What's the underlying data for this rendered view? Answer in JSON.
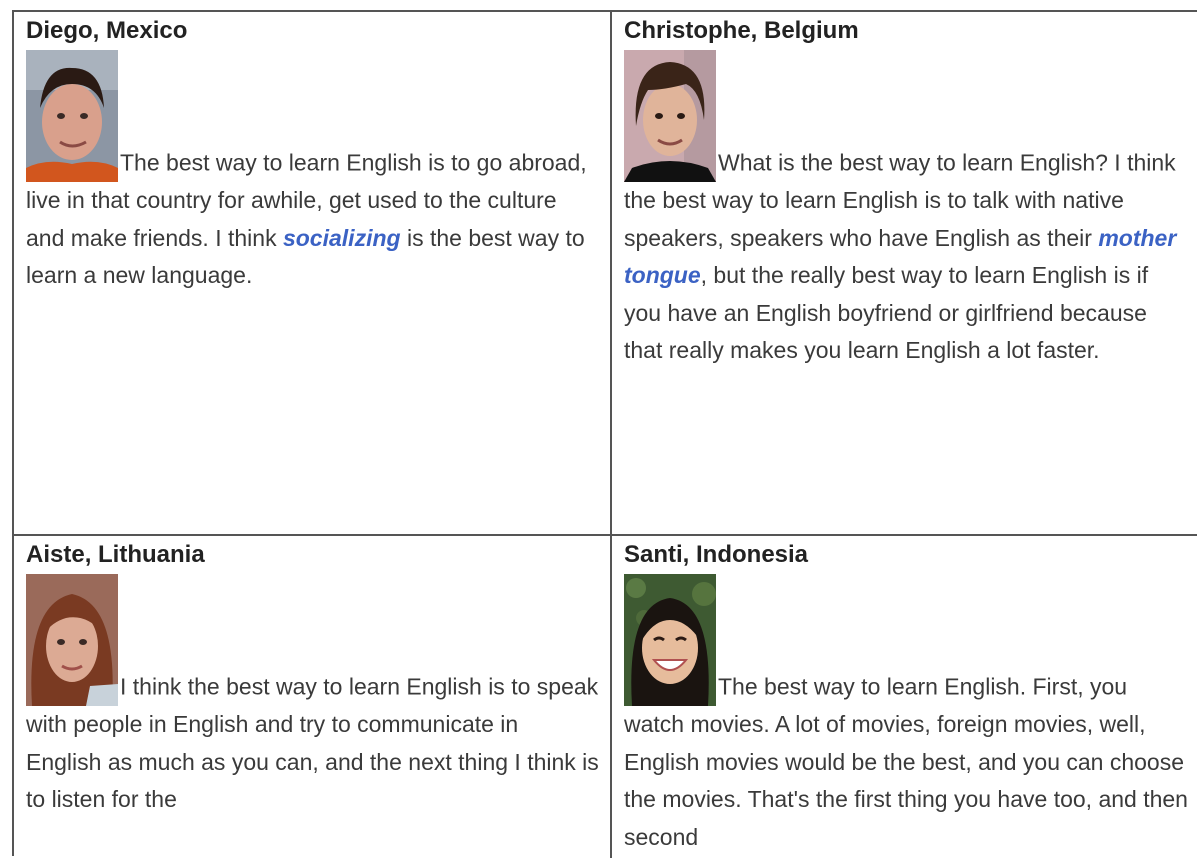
{
  "profiles": [
    {
      "name": "Diego, Mexico",
      "text_before": "The best way to learn English is to go abroad, live in that country for awhile, get used to the culture and make friends. I think ",
      "keyword": "socializing",
      "text_after": " is the best way to learn a new language."
    },
    {
      "name": "Christophe, Belgium",
      "text_before": "What is the best way to learn English? I think the best way to learn English is to talk with native speakers, speakers who have English as their ",
      "keyword": "mother tongue",
      "text_after": ", but the really best way to learn English is if you have an English boyfriend or girlfriend because that really makes you learn English a lot faster."
    },
    {
      "name": "Aiste, Lithuania",
      "text_before": "I think the best way to learn English is to speak with people in English and try to communicate in English as much as you can, and the next thing I think is to listen for the",
      "keyword": "",
      "text_after": ""
    },
    {
      "name": "Santi, Indonesia",
      "text_before": "The best way to learn English. First, you watch movies. A lot of movies, foreign movies, well, English movies would be the best, and you can choose the movies. That's the first thing you have too, and then second",
      "keyword": "",
      "text_after": ""
    }
  ],
  "colors": {
    "keyword": "#3b62c4",
    "border": "#555555",
    "text": "#3a3a3a"
  }
}
